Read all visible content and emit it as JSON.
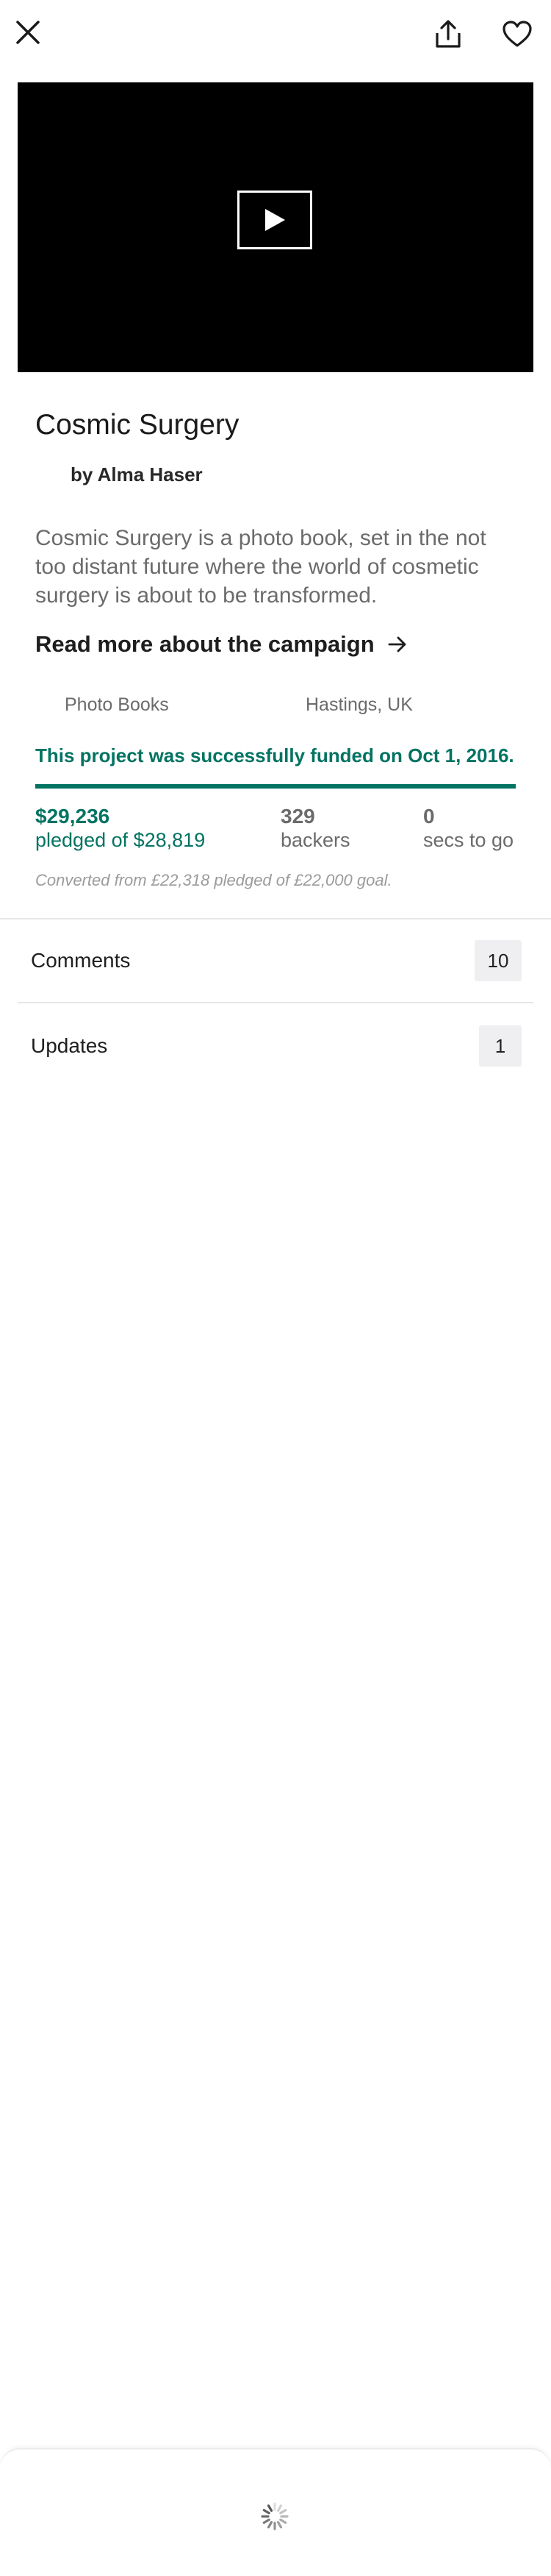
{
  "project": {
    "title": "Cosmic Surgery",
    "byline": "by Alma Haser",
    "blurb": "Cosmic Surgery is a photo book, set in the not too distant future where the world of cosmetic surgery is about to be transformed.",
    "read_more": "Read more about the campaign",
    "category": "Photo Books",
    "location": "Hastings, UK"
  },
  "funding": {
    "status_message": "This project was successfully funded on Oct 1, 2016.",
    "progress_fraction": 1.0,
    "pledged_amount": "$29,236",
    "pledged_label": "pledged of $28,819",
    "backers_count": "329",
    "backers_label": "backers",
    "time_count": "0",
    "time_label": "secs to go",
    "converted_note": "Converted from £22,318 pledged of £22,000 goal."
  },
  "sections": {
    "comments_label": "Comments",
    "comments_count": "10",
    "updates_label": "Updates",
    "updates_count": "1"
  },
  "icons": {
    "close": "close-icon",
    "share": "share-icon",
    "favorite": "heart-icon",
    "play": "play-icon",
    "loading": "spinner-icon"
  },
  "colors": {
    "accent": "#037362",
    "text_muted": "#6b6b6b",
    "badge_bg": "#efeff1"
  }
}
